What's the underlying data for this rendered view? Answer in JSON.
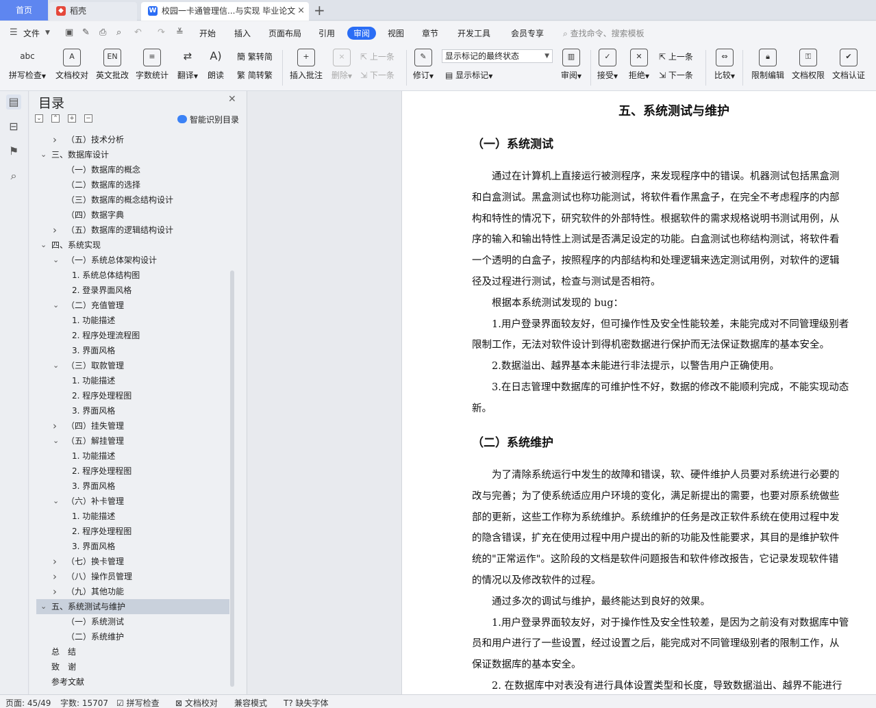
{
  "tabs": {
    "home": "首页",
    "daoke": "稻壳",
    "doc": "校园一卡通管理信...与实现 毕业论文",
    "close": "×",
    "add": "+"
  },
  "menubar": {
    "file": "文件",
    "items": [
      "开始",
      "插入",
      "页面布局",
      "引用",
      "审阅",
      "视图",
      "章节",
      "开发工具",
      "会员专享"
    ],
    "active": "审阅",
    "search": "查找命令、搜索模板"
  },
  "ribbon": {
    "spell": "拼写检查",
    "proof": "文档校对",
    "en_review": "英文批改",
    "wordcount": "字数统计",
    "translate": "翻译",
    "read": "朗读",
    "trad": "繁转简",
    "simp": "简转繁",
    "insert_comment": "插入批注",
    "delete": "删除",
    "prev": "上一条",
    "next": "下一条",
    "track": "修订",
    "markup_state": "显示标记的最终状态",
    "show_markup": "显示标记",
    "review": "审阅",
    "accept": "接受",
    "reject": "拒绝",
    "prev2": "上一条",
    "next2": "下一条",
    "compare": "比较",
    "restrict": "限制编辑",
    "permission": "文档权限",
    "certify": "文档认证"
  },
  "toc": {
    "title": "目录",
    "smart": "智能识别目录",
    "items": [
      {
        "t": "（五）技术分析",
        "lv": 2,
        "chev": "right"
      },
      {
        "t": "三、数据库设计",
        "lv": 1,
        "chev": "down"
      },
      {
        "t": "（一）数据库的概念",
        "lv": 2,
        "chev": ""
      },
      {
        "t": "（二）数据库的选择",
        "lv": 2,
        "chev": ""
      },
      {
        "t": "（三）数据库的概念结构设计",
        "lv": 2,
        "chev": ""
      },
      {
        "t": "（四）数据字典",
        "lv": 2,
        "chev": ""
      },
      {
        "t": "（五）数据库的逻辑结构设计",
        "lv": 2,
        "chev": "right"
      },
      {
        "t": "四、系统实现",
        "lv": 1,
        "chev": "down"
      },
      {
        "t": "（一）系统总体架构设计",
        "lv": 2,
        "chev": "down"
      },
      {
        "t": "1. 系统总体结构图",
        "lv": 3,
        "chev": ""
      },
      {
        "t": "2. 登录界面风格",
        "lv": 3,
        "chev": ""
      },
      {
        "t": "（二）充值管理",
        "lv": 2,
        "chev": "down"
      },
      {
        "t": "1. 功能描述",
        "lv": 3,
        "chev": ""
      },
      {
        "t": "2. 程序处理流程图",
        "lv": 3,
        "chev": ""
      },
      {
        "t": "3. 界面风格",
        "lv": 3,
        "chev": ""
      },
      {
        "t": "（三）取款管理",
        "lv": 2,
        "chev": "down"
      },
      {
        "t": "1. 功能描述",
        "lv": 3,
        "chev": ""
      },
      {
        "t": "2. 程序处理程图",
        "lv": 3,
        "chev": ""
      },
      {
        "t": "3. 界面风格",
        "lv": 3,
        "chev": ""
      },
      {
        "t": "（四）挂失管理",
        "lv": 2,
        "chev": "right"
      },
      {
        "t": "（五）解挂管理",
        "lv": 2,
        "chev": "down"
      },
      {
        "t": "1. 功能描述",
        "lv": 3,
        "chev": ""
      },
      {
        "t": "2. 程序处理程图",
        "lv": 3,
        "chev": ""
      },
      {
        "t": "3. 界面风格",
        "lv": 3,
        "chev": ""
      },
      {
        "t": "（六）补卡管理",
        "lv": 2,
        "chev": "down"
      },
      {
        "t": "1. 功能描述",
        "lv": 3,
        "chev": ""
      },
      {
        "t": "2. 程序处理程图",
        "lv": 3,
        "chev": ""
      },
      {
        "t": "3. 界面风格",
        "lv": 3,
        "chev": ""
      },
      {
        "t": "（七）换卡管理",
        "lv": 2,
        "chev": "right"
      },
      {
        "t": "（八）操作员管理",
        "lv": 2,
        "chev": "right"
      },
      {
        "t": "（九）其他功能",
        "lv": 2,
        "chev": "right"
      },
      {
        "t": "五、系统测试与维护",
        "lv": 1,
        "chev": "down",
        "selected": true
      },
      {
        "t": "（一）系统测试",
        "lv": 2,
        "chev": ""
      },
      {
        "t": "（二）系统维护",
        "lv": 2,
        "chev": ""
      },
      {
        "t": "总　结",
        "lv": 0,
        "chev": ""
      },
      {
        "t": "致　谢",
        "lv": 0,
        "chev": ""
      },
      {
        "t": "参考文献",
        "lv": 0,
        "chev": ""
      }
    ]
  },
  "document": {
    "h1": "五、系统测试与维护",
    "h2a": "（一）系统测试",
    "p1": [
      "　　通过在计算机上直接运行被测程序，来发现程序中的错误。机器测试包括黑盒测",
      "和白盒测试。黑盒测试也称功能测试，将软件看作黑盒子，在完全不考虑程序的内部",
      "构和特性的情况下，研究软件的外部特性。根据软件的需求规格说明书测试用例，从",
      "序的输入和输出特性上测试是否满足设定的功能。白盒测试也称结构测试，将软件看",
      "一个透明的白盒子，按照程序的内部结构和处理逻辑来选定测试用例，对软件的逻辑",
      "径及过程进行测试，检查与测试是否相符。",
      "　　根据本系统测试发现的 bug：",
      "　　1.用户登录界面较友好，但可操作性及安全性能较差，未能完成对不同管理级别者",
      "限制工作，无法对软件设计到得机密数据进行保护而无法保证数据库的基本安全。",
      "　　2.数据溢出、越界基本未能进行非法提示，以警告用户正确使用。",
      "　　3.在日志管理中数据库的可维护性不好，数据的修改不能顺利完成，不能实现动态",
      "新。"
    ],
    "h2b": "（二）系统维护",
    "p2": [
      "　　为了清除系统运行中发生的故障和错误，软、硬件维护人员要对系统进行必要的",
      "改与完善；为了使系统适应用户环境的变化，满足新提出的需要，也要对原系统做些",
      "部的更新，这些工作称为系统维护。系统维护的任务是改正软件系统在使用过程中发",
      "的隐含错误，扩充在使用过程中用户提出的新的功能及性能要求，其目的是维护软件",
      "统的\"正常运作\"。这阶段的文档是软件问题报告和软件修改报告，它记录发现软件错",
      "的情况以及修改软件的过程。",
      "　　通过多次的调试与维护，最终能达到良好的效果。",
      "　　1.用户登录界面较友好，对于操作性及安全性较差，是因为之前没有对数据库中管",
      "员和用户进行了一些设置，经过设置之后，能完成对不同管理级别者的限制工作，从",
      "保证数据库的基本安全。",
      "　　2. 在数据库中对表没有进行具体设置类型和长度，导致数据溢出、越界不能进行"
    ]
  },
  "status": {
    "page": "页面: 45/49",
    "words": "字数: 15707",
    "spell": "拼写检查",
    "proof": "文档校对",
    "compat": "兼容模式",
    "missing_font": "缺失字体"
  }
}
